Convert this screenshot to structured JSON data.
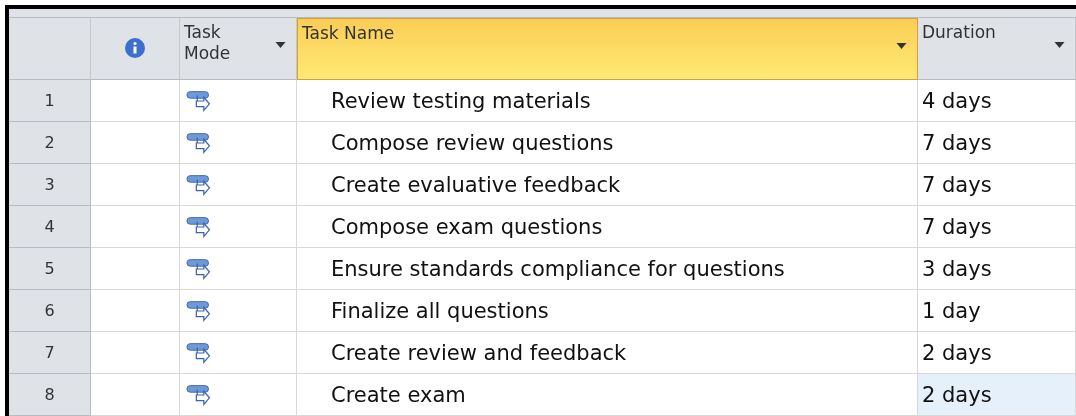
{
  "columns": [
    {
      "kind": "rownum",
      "selected": false
    },
    {
      "kind": "info",
      "selected": false
    },
    {
      "kind": "mode",
      "label": "Task Mode",
      "dropdown": true,
      "selected": false
    },
    {
      "kind": "name",
      "label": "Task Name",
      "dropdown": true,
      "selected": true
    },
    {
      "kind": "duration",
      "label": "Duration",
      "dropdown": true,
      "selected": false
    }
  ],
  "rows": [
    {
      "id": "1",
      "name": "Review testing materials",
      "duration": "4 days",
      "duration_selected": false
    },
    {
      "id": "2",
      "name": "Compose review questions",
      "duration": "7 days",
      "duration_selected": false
    },
    {
      "id": "3",
      "name": "Create evaluative feedback",
      "duration": "7 days",
      "duration_selected": false
    },
    {
      "id": "4",
      "name": "Compose exam questions",
      "duration": "7 days",
      "duration_selected": false
    },
    {
      "id": "5",
      "name": "Ensure standards compliance for questions",
      "duration": "3 days",
      "duration_selected": false
    },
    {
      "id": "6",
      "name": "Finalize all questions",
      "duration": "1 day",
      "duration_selected": false
    },
    {
      "id": "7",
      "name": "Create review and feedback",
      "duration": "2 days",
      "duration_selected": false
    },
    {
      "id": "8",
      "name": "Create exam",
      "duration": "2 days",
      "duration_selected": true
    }
  ]
}
